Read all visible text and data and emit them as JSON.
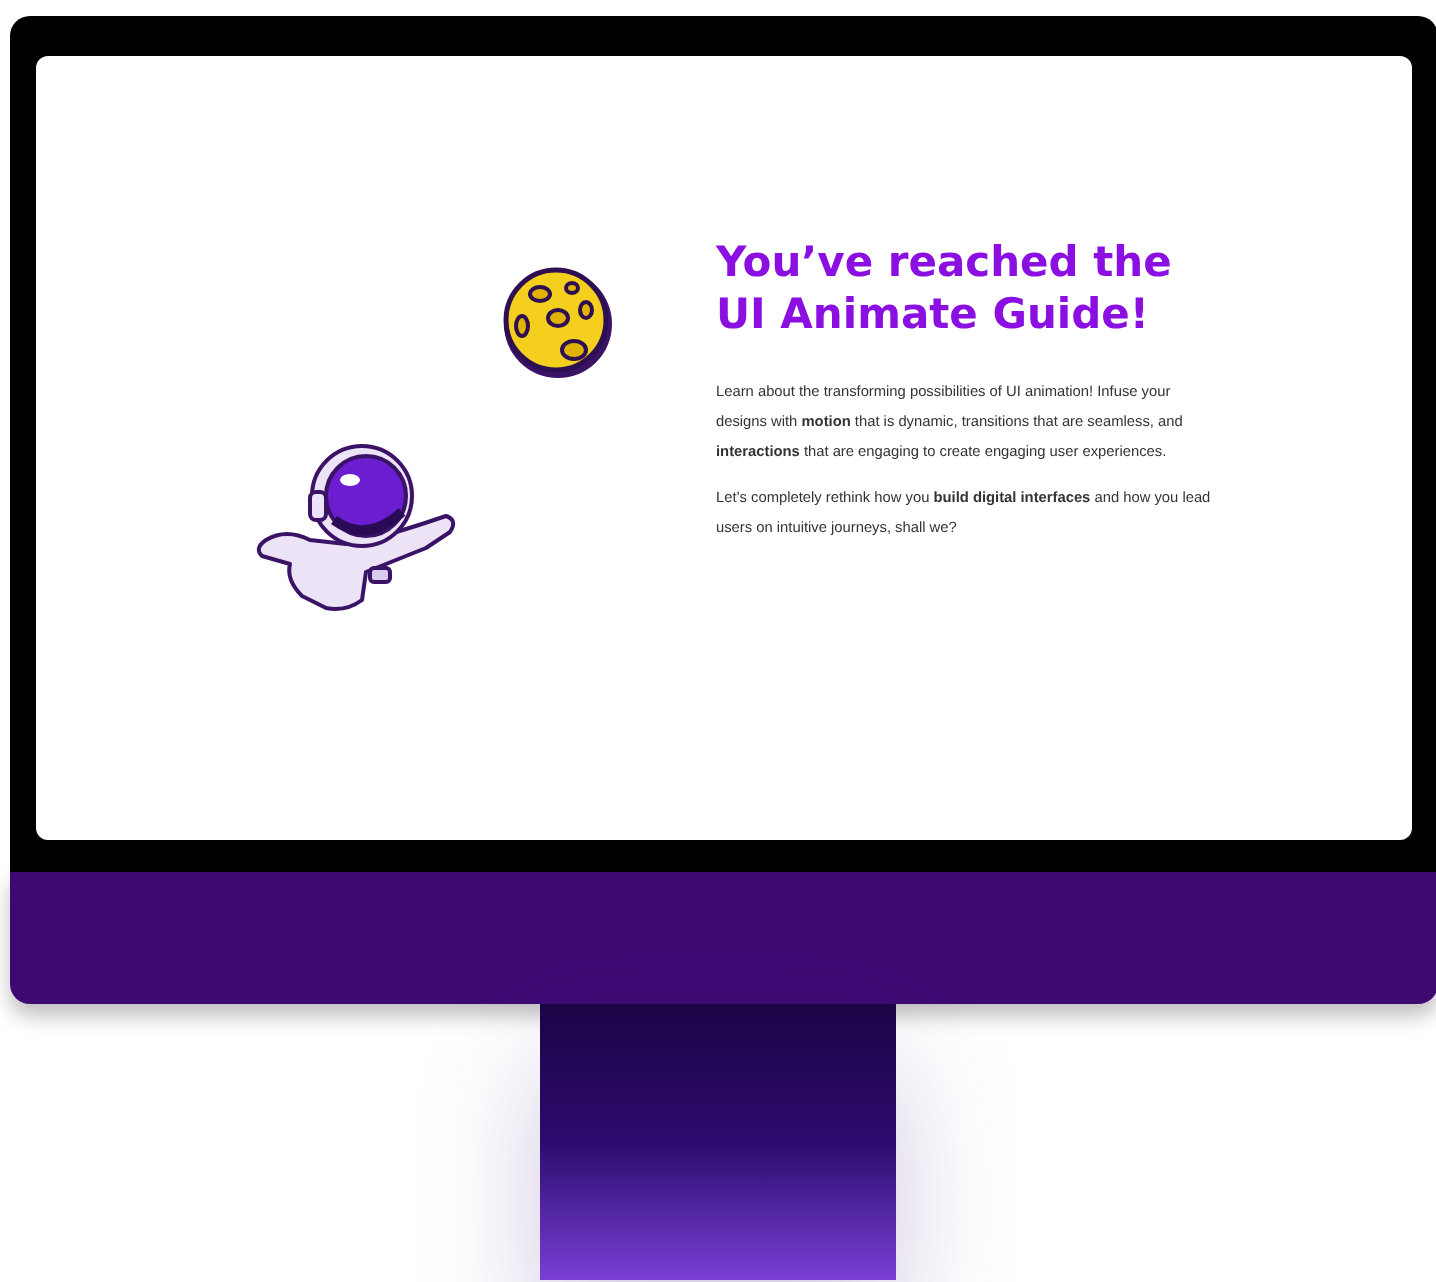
{
  "hero": {
    "title_lines": [
      "You’ve reached the",
      "UI Animate Guide!"
    ],
    "paragraphs": [
      "Learn about the transforming possibilities of UI animation! Infuse your designs with **motion** that is dynamic, transitions that are seamless, and **interactions** that are engaging to create engaging user experiences.",
      "Let’s completely rethink how you **build digital interfaces** and how you lead users on intuitive journeys, shall we?"
    ]
  }
}
